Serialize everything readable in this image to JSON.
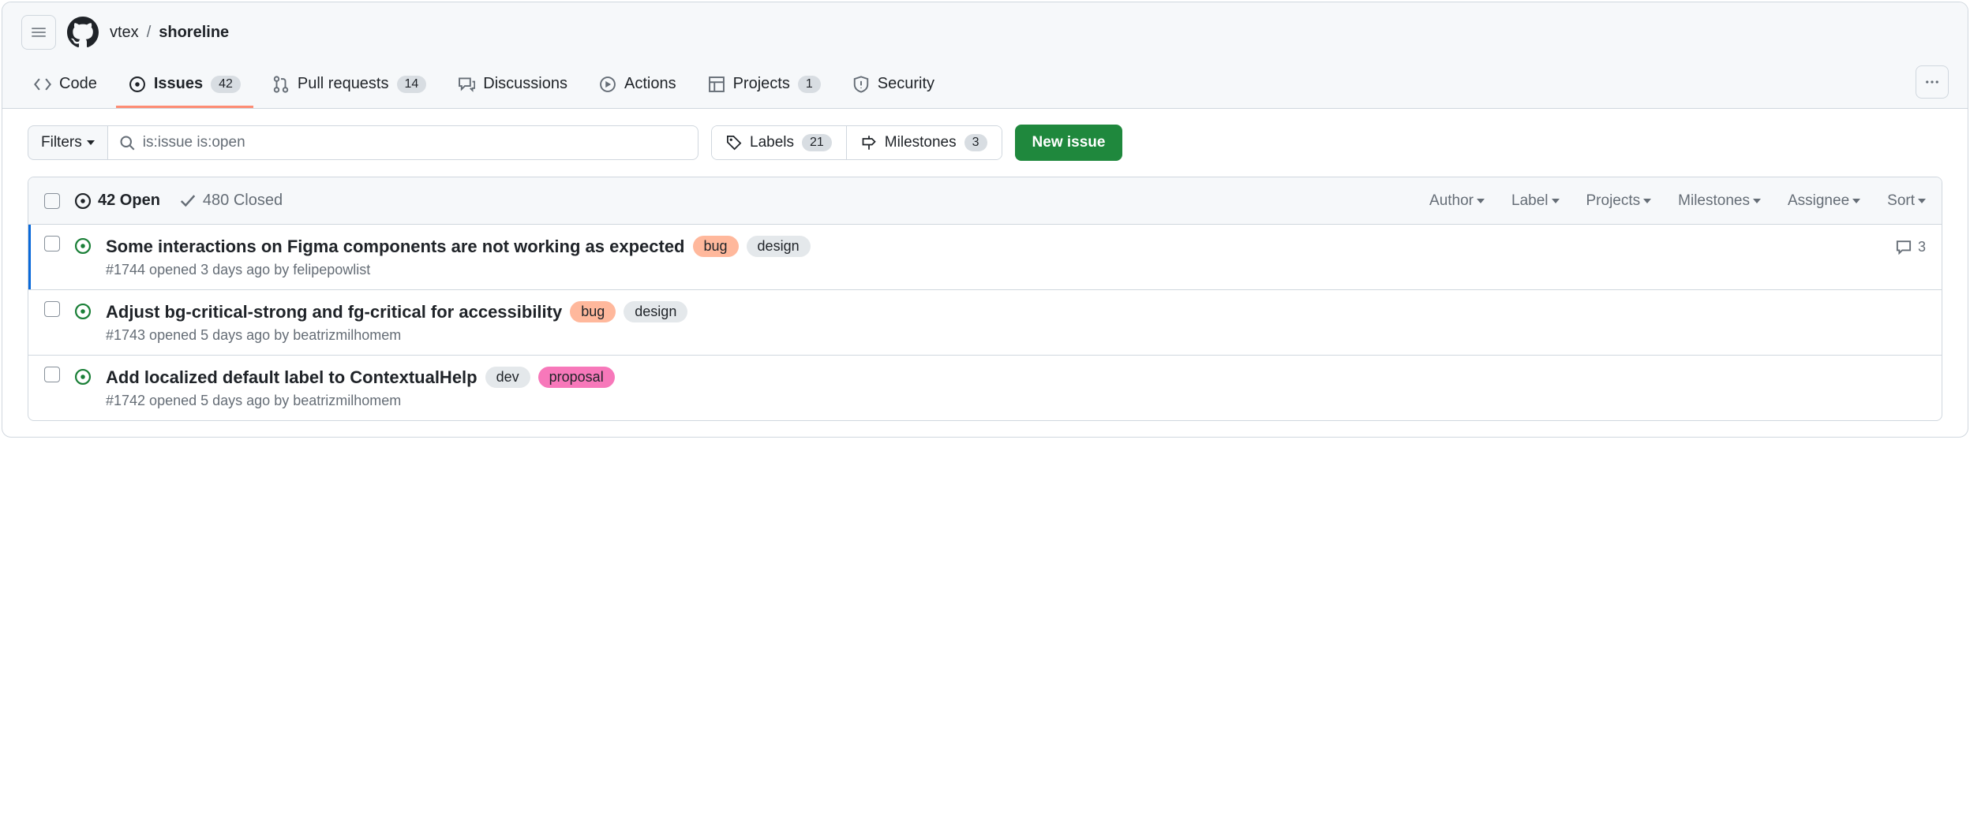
{
  "breadcrumb": {
    "owner": "vtex",
    "sep": "/",
    "repo": "shoreline"
  },
  "nav": {
    "code": "Code",
    "issues": "Issues",
    "issues_count": "42",
    "pulls": "Pull requests",
    "pulls_count": "14",
    "discussions": "Discussions",
    "actions": "Actions",
    "projects": "Projects",
    "projects_count": "1",
    "security": "Security"
  },
  "toolbar": {
    "filters": "Filters",
    "search_value": "is:issue is:open",
    "labels": "Labels",
    "labels_count": "21",
    "milestones": "Milestones",
    "milestones_count": "3",
    "new_issue": "New issue"
  },
  "list_header": {
    "open": "42 Open",
    "closed": "480 Closed",
    "author": "Author",
    "label": "Label",
    "projects": "Projects",
    "milestones": "Milestones",
    "assignee": "Assignee",
    "sort": "Sort"
  },
  "label_colors": {
    "bug": {
      "bg": "#ffb89c",
      "fg": "#1f2328"
    },
    "design": {
      "bg": "#e4e8eb",
      "fg": "#1f2328"
    },
    "dev": {
      "bg": "#e4e8eb",
      "fg": "#1f2328"
    },
    "proposal": {
      "bg": "#f778ba",
      "fg": "#1f2328"
    }
  },
  "issues": [
    {
      "title": "Some interactions on Figma components are not working as expected",
      "labels": [
        "bug",
        "design"
      ],
      "meta": "#1744 opened 3 days ago by felipepowlist",
      "comments": "3",
      "highlighted": true
    },
    {
      "title": "Adjust bg-critical-strong and fg-critical for accessibility",
      "labels": [
        "bug",
        "design"
      ],
      "meta": "#1743 opened 5 days ago by beatrizmilhomem",
      "comments": null,
      "highlighted": false
    },
    {
      "title": "Add localized default label to ContextualHelp",
      "labels": [
        "dev",
        "proposal"
      ],
      "meta": "#1742 opened 5 days ago by beatrizmilhomem",
      "comments": null,
      "highlighted": false
    }
  ]
}
